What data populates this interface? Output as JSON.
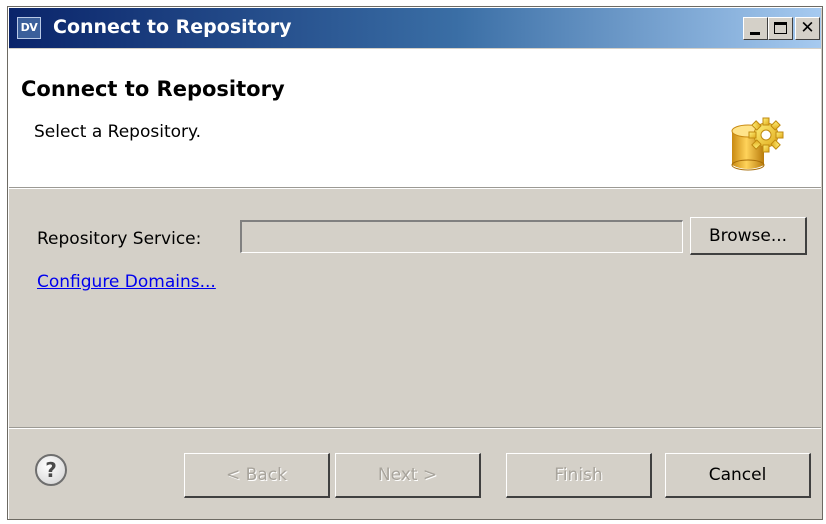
{
  "window": {
    "title": "Connect to Repository",
    "app_icon_text": "DV"
  },
  "header": {
    "title": "Connect to Repository",
    "subtitle": "Select a Repository.",
    "icon": "repository-gear-icon"
  },
  "form": {
    "repo_service_label": "Repository Service:",
    "repo_service_value": "",
    "browse_label": "Browse...",
    "configure_link": "Configure Domains..."
  },
  "footer": {
    "help_icon": "help-icon",
    "back_label": "< Back",
    "next_label": "Next >",
    "finish_label": "Finish",
    "cancel_label": "Cancel"
  },
  "colors": {
    "titlebar_start": "#0a246a",
    "titlebar_end": "#a6caf0",
    "dialog_bg": "#d4d0c8",
    "link": "#0000ee"
  }
}
